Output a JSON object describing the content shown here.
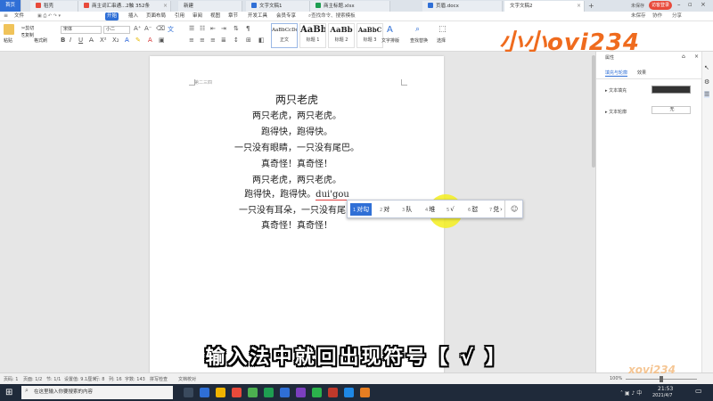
{
  "tabs": [
    {
      "label": "首页",
      "kind": "home"
    },
    {
      "label": "稻壳",
      "kind": "normal",
      "color": "#e84a3b"
    },
    {
      "label": "商主词汇串通...2触 352条",
      "kind": "normal",
      "color": "#e84a3b"
    },
    {
      "label": "新建",
      "kind": "normal",
      "color": "#2f6fd6"
    },
    {
      "label": "文字文稿1",
      "kind": "normal",
      "color": "#2f6fd6"
    },
    {
      "label": "商主标题.xlsx",
      "kind": "normal",
      "color": "#1e9e51"
    },
    {
      "label": "页眉.docx",
      "kind": "normal",
      "color": "#2f6fd6"
    },
    {
      "label": "文字文稿2",
      "kind": "active",
      "color": "#2f6fd6"
    }
  ],
  "window": {
    "status_left": "未保存",
    "status_btn": "访客登录"
  },
  "menus": [
    "文件",
    "开始",
    "插入",
    "页面布局",
    "引用",
    "审阅",
    "视图",
    "章节",
    "开发工具",
    "会员专享"
  ],
  "menu_search": "查找命令、搜索模板",
  "menu_right": [
    "未保存",
    "协作",
    "分享"
  ],
  "toolbar": {
    "paste": "粘贴",
    "cut": "剪切",
    "copy": "复制",
    "format_painter": "格式刷",
    "font": "宋体",
    "size": "小二",
    "styles": [
      {
        "preview": "AaBbCcDd",
        "label": "正文"
      },
      {
        "preview": "AaBb",
        "label": "标题 1"
      },
      {
        "preview": "AaBb",
        "label": "标题 2"
      },
      {
        "preview": "AaBbC",
        "label": "标题 3"
      }
    ],
    "text_tools": "文字排版",
    "find_replace": "查找替换",
    "select": "选择"
  },
  "logo": "小小ovi234",
  "document": {
    "header_mark": "第二三四",
    "lines": [
      "两只老虎",
      "两只老虎，两只老虎。",
      "跑得快，跑得快。",
      "一只没有眼睛，一只没有尾巴。",
      "真奇怪！真奇怪！",
      "两只老虎，两只老虎。",
      "跑得快，跑得快。",
      "一只没有耳朵，一只没有尾巴",
      "真奇怪！真奇怪！"
    ],
    "pinyin": "dui'gou"
  },
  "ime": {
    "candidates": [
      {
        "n": "1",
        "text": "对勾",
        "selected": true
      },
      {
        "n": "2",
        "text": "对",
        "selected": false
      },
      {
        "n": "3",
        "text": "队",
        "selected": false
      },
      {
        "n": "4",
        "text": "堆",
        "selected": false
      },
      {
        "n": "5",
        "text": "√",
        "selected": false
      },
      {
        "n": "6",
        "text": "怼",
        "selected": false
      },
      {
        "n": "7",
        "text": "兑",
        "selected": false
      }
    ],
    "arrow": "›",
    "emoji": "☺"
  },
  "right_panel": {
    "title": "属性",
    "tabs": [
      "填充与轮廓",
      "效果"
    ],
    "rows": [
      {
        "label": "文本填充",
        "value": ""
      },
      {
        "label": "文本轮廓",
        "value": "无"
      }
    ]
  },
  "statusbar": {
    "items": [
      "页码: 1",
      "页面: 1/2",
      "节: 1/1",
      "设置值: 9.1厘米",
      "行: 8",
      "列: 16",
      "字数: 143",
      "拼写检查",
      "文档校对"
    ],
    "zoom": "100%"
  },
  "taskbar": {
    "search_placeholder": "在这里输入你要搜索的内容",
    "time": "21:53",
    "date": "2021/4/7"
  },
  "caption": "输入法中就回出现符号【 √ 】",
  "watermark": "xovi234"
}
